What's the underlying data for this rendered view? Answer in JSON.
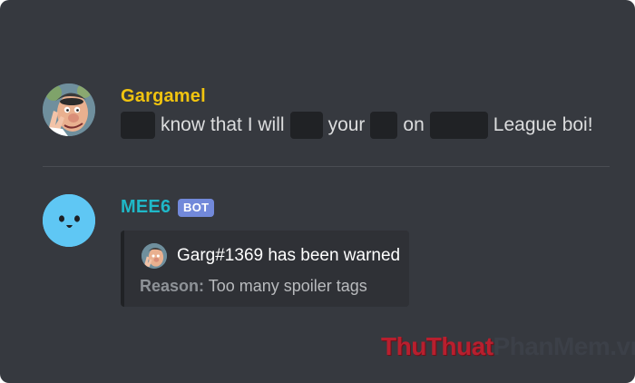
{
  "messages": {
    "first": {
      "author": "Gargamel",
      "author_color": "#f1c40f",
      "text_parts": [
        "know that I will",
        "your",
        "on",
        "League boi!"
      ]
    },
    "second": {
      "author": "MEE6",
      "author_color": "#1fb8c8",
      "badge": "BOT",
      "embed": {
        "author_text": "Garg#1369 has been warned",
        "reason_label": "Reason:",
        "reason_text": "Too many spoiler tags"
      }
    }
  },
  "watermark": {
    "part1": "ThuThuat",
    "part2": "PhanMem",
    "part3": ".vn"
  },
  "colors": {
    "background": "#36393f",
    "spoiler": "#202225",
    "bot_badge": "#7289da",
    "embed_bg": "#2f3136"
  },
  "icons": {
    "gargamel_avatar": "gargamel-avatar-icon",
    "mee6_avatar": "mee6-face-icon"
  }
}
